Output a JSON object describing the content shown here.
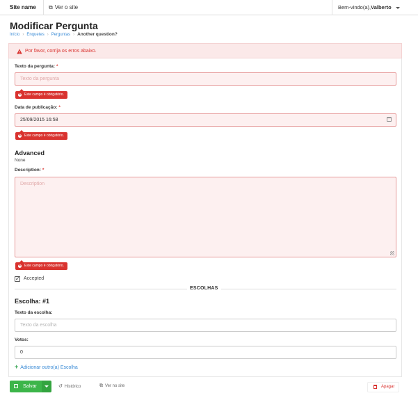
{
  "topbar": {
    "site_name": "Site name",
    "view_site": "Ver o site",
    "welcome_prefix": "Bem-vindo(a),",
    "user": "Valberto"
  },
  "page": {
    "title": "Modificar Pergunta",
    "breadcrumb": [
      "Início",
      "Enquetes",
      "Perguntas"
    ],
    "breadcrumb_current": "Another question?"
  },
  "errors": {
    "banner": "Por favor, corrija os erros abaixo.",
    "required": "Este campo é obrigatório."
  },
  "form": {
    "question_text_label": "Texto da pergunta:",
    "question_text_placeholder": "Texto da pergunta",
    "pub_date_label": "Data de publicação:",
    "pub_date_value": "25/09/2015 16:58",
    "advanced_title": "Advanced",
    "advanced_value": "None",
    "description_label": "Description:",
    "description_placeholder": "Description",
    "accepted_label": "Accepted"
  },
  "choices": {
    "section_label": "ESCOLHAS",
    "choice_title": "Escolha: #1",
    "choice_text_label": "Texto da escolha:",
    "choice_text_placeholder": "Texto da escolha",
    "votes_label": "Votos:",
    "votes_value": "0",
    "add_label": "Adicionar outro(a) Escolha"
  },
  "footer": {
    "save": "Salvar",
    "history": "Histórico",
    "view_site": "Ver no site",
    "delete": "Apagar"
  },
  "colors": {
    "error": "#d9332f",
    "save": "#3cb549",
    "link": "#3a8bd6"
  }
}
